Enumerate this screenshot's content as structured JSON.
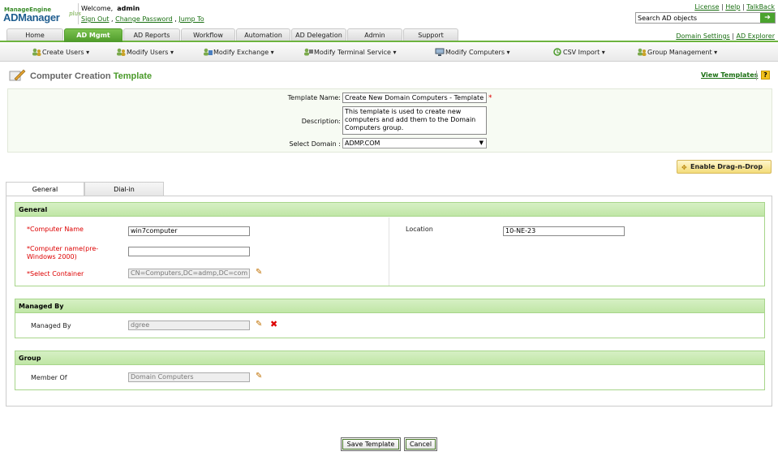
{
  "brand": {
    "manageengine": "ManageEngine",
    "product": "ADManager",
    "plus": "plus"
  },
  "header": {
    "welcome": "Welcome,",
    "user": "admin",
    "sign_out": "Sign Out",
    "change_password": "Change Password",
    "jump_to": "Jump To",
    "license": "License",
    "help": "Help",
    "talkback": "TalkBack",
    "search_value": "Search AD objects",
    "domain_settings": "Domain Settings",
    "ad_explorer": "AD Explorer"
  },
  "tabs": [
    {
      "label": "Home"
    },
    {
      "label": "AD Mgmt"
    },
    {
      "label": "AD Reports"
    },
    {
      "label": "Workflow"
    },
    {
      "label": "Automation"
    },
    {
      "label": "AD Delegation"
    },
    {
      "label": "Admin"
    },
    {
      "label": "Support"
    }
  ],
  "toolbar": [
    "Create Users ▾",
    "Modify Users ▾",
    "Modify Exchange ▾",
    "Modify Terminal Service ▾",
    "Modify Computers ▾",
    "CSV Import ▾",
    "Group Management ▾"
  ],
  "page": {
    "title_a": "Computer Creation",
    "title_b": "Template",
    "view_templates": "View Templates",
    "help_icon": "?"
  },
  "template": {
    "name_label": "Template Name:",
    "name_value": "Create New Domain Computers - Template",
    "desc_label": "Description:",
    "desc_value": "This template is used to create new computers and add them to the Domain Computers group.",
    "domain_label": "Select Domain :",
    "domain_value": "ADMP.COM"
  },
  "dnd": "Enable Drag-n-Drop",
  "subtabs": [
    "General",
    "Dial-in"
  ],
  "general": {
    "header": "General",
    "computer_name_label": "Computer Name",
    "computer_name_value": "win7computer",
    "pre2000_label": "Computer name(pre-Windows 2000)",
    "pre2000_value": "",
    "container_label": "Select Container",
    "container_value": "CN=Computers,DC=admp,DC=com",
    "location_label": "Location",
    "location_value": "10-NE-23"
  },
  "managed": {
    "header": "Managed By",
    "label": "Managed By",
    "value": "dgree"
  },
  "group": {
    "header": "Group",
    "label": "Member Of",
    "value": "Domain Computers"
  },
  "buttons": {
    "save": "Save Template",
    "cancel": "Cancel"
  }
}
